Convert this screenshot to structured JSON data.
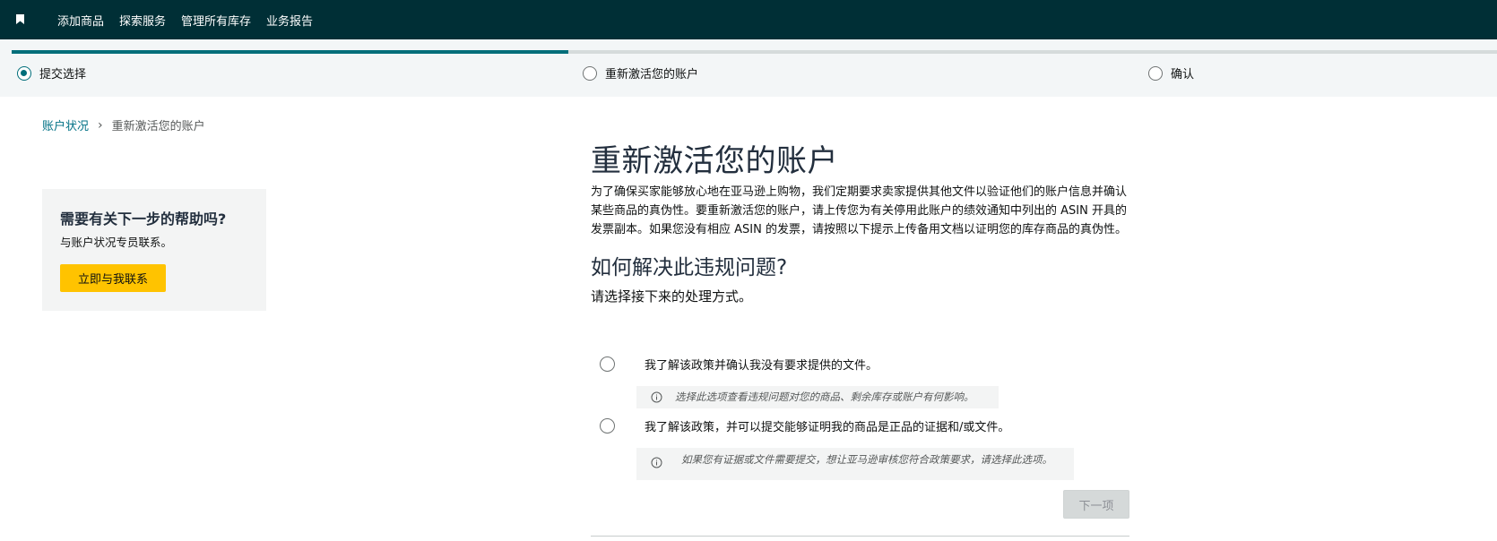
{
  "nav": {
    "items": [
      "添加商品",
      "探索服务",
      "管理所有库存",
      "业务报告"
    ]
  },
  "stepper": {
    "progress_percent": 37.5,
    "steps": [
      {
        "label": "提交选择",
        "active": true
      },
      {
        "label": "重新激活您的账户",
        "active": false
      },
      {
        "label": "确认",
        "active": false
      }
    ]
  },
  "breadcrumb": {
    "parent": "账户状况",
    "separator": "›",
    "current": "重新激活您的账户"
  },
  "help": {
    "title": "需要有关下一步的帮助吗?",
    "subtitle": "与账户状况专员联系。",
    "button_label": "立即与我联系"
  },
  "main": {
    "title": "重新激活您的账户",
    "intro": "为了确保买家能够放心地在亚马逊上购物，我们定期要求卖家提供其他文件以验证他们的账户信息并确认某些商品的真伪性。要重新激活您的账户，请上传您为有关停用此账户的绩效通知中列出的 ASIN 开具的发票副本。如果您没有相应 ASIN 的发票，请按照以下提示上传备用文档以证明您的库存商品的真伪性。",
    "section_title": "如何解决此违规问题?",
    "instruction": "请选择接下来的处理方式。",
    "options": [
      {
        "label": "我了解该政策并确认我没有要求提供的文件。",
        "hint": "选择此选项查看违规问题对您的商品、剩余库存或账户有何影响。"
      },
      {
        "label": "我了解该政策，并可以提交能够证明我的商品是正品的证据和/或文件。",
        "hint": "如果您有证据或文件需要提交，想让亚马逊审核您符合政策要求，请选择此选项。"
      }
    ],
    "next_label": "下一项"
  },
  "colors": {
    "nav_bg": "#002f36",
    "accent": "#006e7a",
    "link": "#007185",
    "contact_button": "#ffc300",
    "disabled_button": "#d5d9d9"
  },
  "icons": [
    "bookmark-icon",
    "chevron-right-icon",
    "info-icon"
  ]
}
